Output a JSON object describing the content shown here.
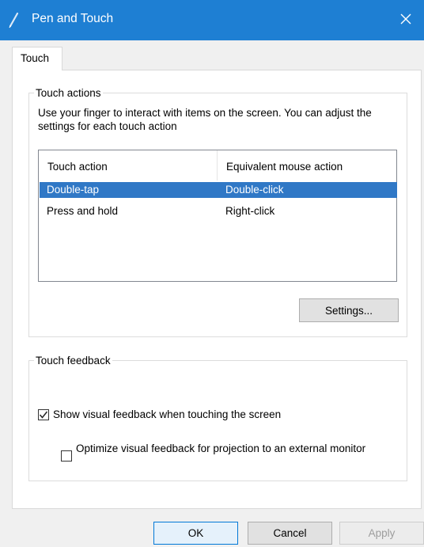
{
  "window": {
    "title": "Pen and Touch",
    "accent": "#1e7fd3"
  },
  "tabs": [
    {
      "label": "Touch",
      "selected": true
    }
  ],
  "touch_actions": {
    "legend": "Touch actions",
    "description": "Use your finger to interact with items on the screen. You can adjust the settings for each touch action",
    "columns": [
      "Touch action",
      "Equivalent mouse action"
    ],
    "rows": [
      {
        "action": "Double-tap",
        "mouse": "Double-click",
        "selected": true
      },
      {
        "action": "Press and hold",
        "mouse": "Right-click",
        "selected": false
      }
    ],
    "settings_label": "Settings..."
  },
  "touch_feedback": {
    "legend": "Touch feedback",
    "show_visual": {
      "label": "Show visual feedback when touching the screen",
      "checked": true
    },
    "optimize": {
      "label": "Optimize visual feedback for projection to an external monitor",
      "checked": false
    }
  },
  "buttons": {
    "ok": "OK",
    "cancel": "Cancel",
    "apply": "Apply",
    "apply_enabled": false
  },
  "icons": {
    "title": "pen-icon",
    "close": "close-icon",
    "check": "checkmark-icon"
  }
}
